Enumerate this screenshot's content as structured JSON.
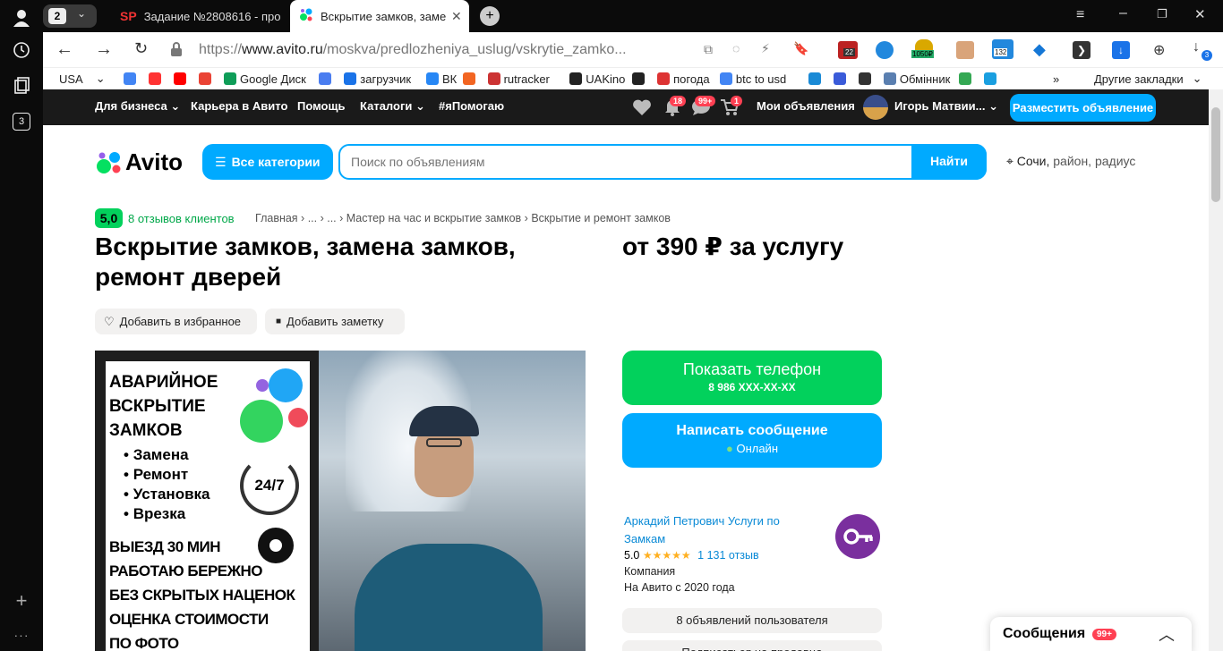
{
  "browser": {
    "tab_count": "2",
    "tabs": [
      {
        "favicon": "SP",
        "title": "Задание №2808616 - про"
      },
      {
        "favicon": "avito-icon",
        "title": "Вскрытие замков, заме"
      }
    ],
    "url_prefix": "https://",
    "url_domain": "www.avito.ru",
    "url_path": "/moskva/predlozheniya_uslug/vskrytie_zamko...",
    "rail_counter": "3",
    "extension_badges": {
      "ext1": "22",
      "ext2": "1050₽",
      "ext3": "132"
    },
    "downloads_badge": "3",
    "bookmarks": [
      {
        "label": "USA",
        "icon": "usa-flag-icon"
      },
      {
        "label": "",
        "icon": "google-icon"
      },
      {
        "label": "",
        "icon": "yandex-icon"
      },
      {
        "label": "",
        "icon": "youtube-icon"
      },
      {
        "label": "",
        "icon": "gmail-icon"
      },
      {
        "label": "Google Диск",
        "icon": "google-drive-icon"
      },
      {
        "label": "",
        "icon": "translate-icon"
      },
      {
        "label": "загрузчик",
        "icon": "loader-icon"
      },
      {
        "label": "ВК",
        "icon": "vk-icon"
      },
      {
        "label": "",
        "icon": "f-icon"
      },
      {
        "label": "rutracker",
        "icon": "rutracker-icon"
      },
      {
        "label": "UAKino",
        "icon": "uakino-icon"
      },
      {
        "label": "",
        "icon": "chess-icon"
      },
      {
        "label": "погода",
        "icon": "thermometer-icon"
      },
      {
        "label": "btc to usd",
        "icon": "google-icon"
      },
      {
        "label": "",
        "icon": "p-icon"
      },
      {
        "label": "",
        "icon": "arrow-icon"
      },
      {
        "label": "",
        "icon": "bc-icon"
      },
      {
        "label": "Обмінник",
        "icon": "exchange-icon"
      },
      {
        "label": "",
        "icon": "maps-icon"
      },
      {
        "label": "",
        "icon": "star-icon"
      }
    ],
    "more_bookmarks": "»",
    "other_bookmarks": "Другие закладки"
  },
  "avito_nav": {
    "items": [
      "Для бизнеса",
      "Карьера в Авито",
      "Помощь",
      "Каталоги",
      "#яПомогаю"
    ],
    "notifications_badge": "18",
    "messages_badge": "99+",
    "cart_badge": "1",
    "my_ads": "Мои объявления",
    "user_name": "Игорь Матвии...",
    "post_ad_button": "Разместить объявление"
  },
  "search": {
    "logo_text": "Avito",
    "categories_button": "Все категории",
    "placeholder": "Поиск по объявлениям",
    "find_button": "Найти",
    "location_city": "Сочи,",
    "location_rest": " район, радиус"
  },
  "listing": {
    "rating_value": "5,0",
    "reviews_link": "8 отзывов клиентов",
    "breadcrumbs": [
      "Главная",
      "...",
      "...",
      "Мастер на час и вскрытие замков",
      "Вскрытие и ремонт замков"
    ],
    "title": "Вскрытие замков, замена замков, ремонт дверей",
    "price": "от 390 ₽ за услугу",
    "favorite_button": "Добавить в избранное",
    "note_button": "Добавить заметку",
    "photo_text": {
      "headline": [
        "АВАРИЙНОЕ",
        "ВСКРЫТИЕ",
        "ЗАМКОВ"
      ],
      "bullets": [
        "Замена",
        "Ремонт",
        "Установка",
        "Врезка"
      ],
      "badge": "24/7",
      "lines": [
        "ВЫЕЗД 30 МИН",
        "РАБОТАЮ БЕРЕЖНО",
        "БЕЗ СКРЫТЫХ НАЦЕНОК",
        "ОЦЕНКА СТОИМОСТИ",
        "ПО ФОТО"
      ]
    }
  },
  "contact": {
    "phone_button": "Показать телефон",
    "phone_masked": "8 986 XXX-XX-XX",
    "message_button": "Написать сообщение",
    "online_status": "Онлайн",
    "colors": {
      "green": "#02d15c",
      "blue": "#00aaff",
      "purple": "#7a2f9e"
    }
  },
  "seller": {
    "name": "Аркадий Петрович Услуги по Замкам",
    "rating": "5.0",
    "stars": "★★★★★",
    "reviews": "1 131 отзыв",
    "type": "Компания",
    "since": "На Авито с 2020 года",
    "ads_button": "8 объявлений пользователя",
    "subscribe_button": "Подписаться на продавца"
  },
  "messenger": {
    "label": "Сообщения",
    "badge": "99+"
  }
}
